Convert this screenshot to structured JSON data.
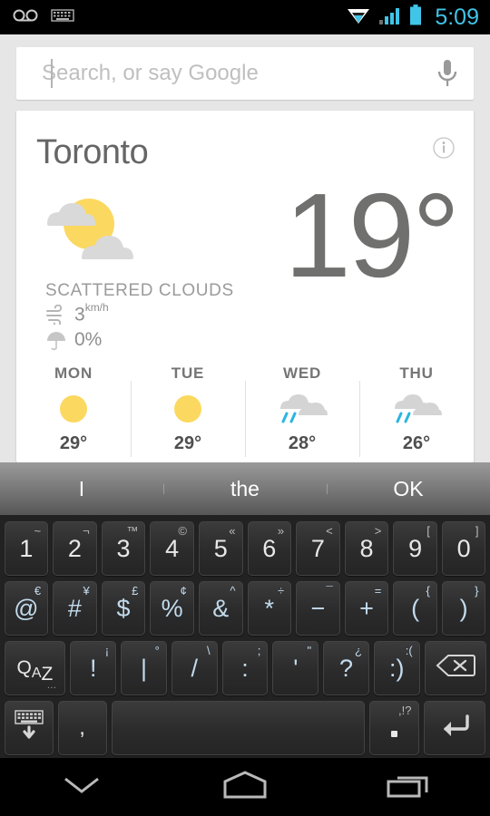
{
  "statusbar": {
    "icons": [
      "voicemail-icon",
      "keyboard-icon",
      "wifi-icon",
      "signal-icon",
      "battery-icon"
    ],
    "clock": "5:09",
    "accent_color": "#40c4e8"
  },
  "search": {
    "placeholder": "Search, or say Google",
    "value": "",
    "mic_icon": "microphone-icon"
  },
  "weather_card": {
    "city": "Toronto",
    "info_icon": "info-icon",
    "condition": "SCATTERED CLOUDS",
    "current_icon": "sun-behind-clouds-icon",
    "temperature": "19°",
    "wind": {
      "icon": "wind-icon",
      "value": "3",
      "unit": "km/h"
    },
    "precipitation": {
      "icon": "umbrella-icon",
      "value": "0%"
    },
    "forecast": [
      {
        "day": "MON",
        "icon": "sun-icon",
        "temp": "29°"
      },
      {
        "day": "TUE",
        "icon": "sun-icon",
        "temp": "29°"
      },
      {
        "day": "WED",
        "icon": "rain-icon",
        "temp": "28°"
      },
      {
        "day": "THU",
        "icon": "rain-icon",
        "temp": "26°"
      }
    ],
    "colors": {
      "sun": "#fbd85f",
      "cloud": "#d8d8d8",
      "rain": "#29b6e0",
      "temp_text": "#70706f"
    }
  },
  "keyboard": {
    "suggestions": [
      "I",
      "the",
      "OK"
    ],
    "rows": [
      [
        {
          "main": "1",
          "hint": "~"
        },
        {
          "main": "2",
          "hint": "¬"
        },
        {
          "main": "3",
          "hint": "™"
        },
        {
          "main": "4",
          "hint": "©"
        },
        {
          "main": "5",
          "hint": "«"
        },
        {
          "main": "6",
          "hint": "»"
        },
        {
          "main": "7",
          "hint": "<"
        },
        {
          "main": "8",
          "hint": ">"
        },
        {
          "main": "9",
          "hint": "["
        },
        {
          "main": "0",
          "hint": "]"
        }
      ],
      [
        {
          "main": "@",
          "hint": "€"
        },
        {
          "main": "#",
          "hint": "¥"
        },
        {
          "main": "$",
          "hint": "£"
        },
        {
          "main": "%",
          "hint": "¢"
        },
        {
          "main": "&",
          "hint": "^"
        },
        {
          "main": "*",
          "hint": "÷"
        },
        {
          "main": "−",
          "hint": "¯"
        },
        {
          "main": "+",
          "hint": "="
        },
        {
          "main": "(",
          "hint": "{"
        },
        {
          "main": ")",
          "hint": "}"
        }
      ],
      [
        {
          "main": "QAZ",
          "hint": "…",
          "type": "alpha-toggle"
        },
        {
          "main": "!",
          "hint": "¡"
        },
        {
          "main": "|",
          "hint": "°"
        },
        {
          "main": "/",
          "hint": "\\"
        },
        {
          "main": ":",
          "hint": ";"
        },
        {
          "main": "'",
          "hint": "\""
        },
        {
          "main": "?",
          "hint": "¿"
        },
        {
          "main": ":)",
          "hint": ":("
        },
        {
          "main": "⌫",
          "hint": "",
          "type": "delete"
        }
      ],
      [
        {
          "main": "",
          "hint": "",
          "type": "hide-keyboard"
        },
        {
          "main": ",",
          "hint": "",
          "type": "comma"
        },
        {
          "main": "",
          "hint": "",
          "type": "space"
        },
        {
          "main": ".",
          "hint": ",!?",
          "type": "period"
        },
        {
          "main": "⏎",
          "hint": "",
          "type": "enter"
        }
      ]
    ]
  },
  "navbar": {
    "back_label": "back-collapse-keyboard",
    "home_label": "home",
    "recents_label": "recent-apps"
  }
}
